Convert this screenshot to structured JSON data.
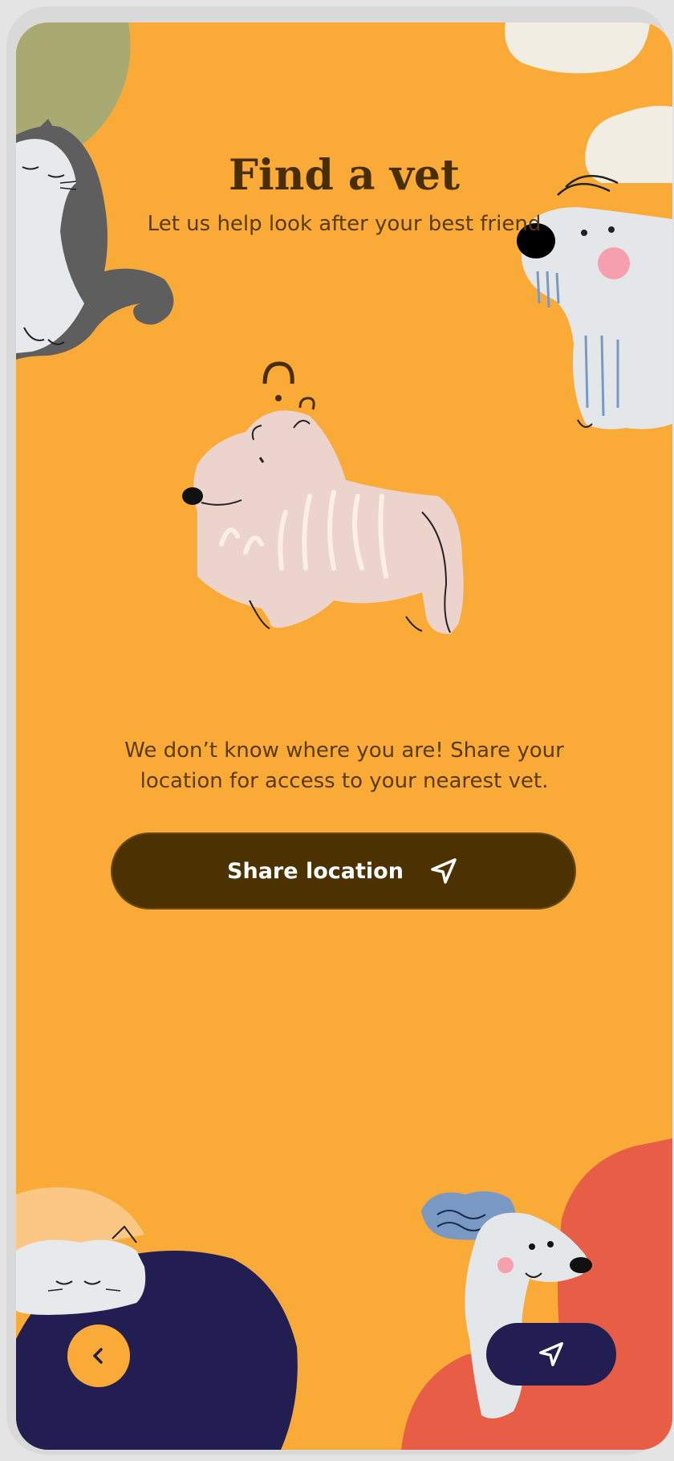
{
  "header": {
    "title": "Find a vet",
    "subtitle": "Let us help look after your best friend"
  },
  "main": {
    "message_line1": "We don’t know where you are! Share your",
    "message_line2": "location for access to your nearest vet.",
    "share_button_label": "Share location",
    "share_button_icon": "navigation-arrow-icon",
    "illustration": "confused-dog-illustration"
  },
  "footer": {
    "back_icon": "chevron-left-icon",
    "location_icon": "navigation-arrow-icon"
  },
  "colors": {
    "background": "#faab37",
    "primary_dark": "#4c3201",
    "navy": "#231e52",
    "coral": "#e85d45",
    "text": "#5a3b08"
  }
}
